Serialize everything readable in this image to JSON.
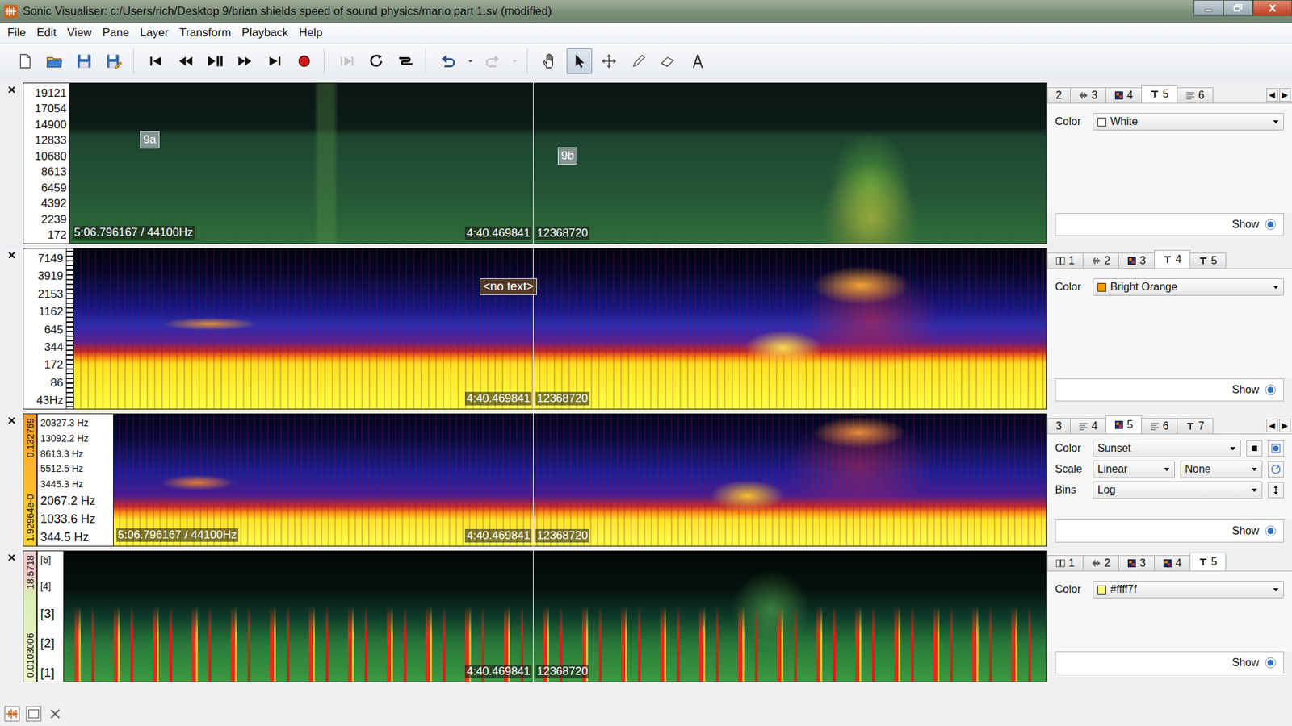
{
  "window": {
    "title": "Sonic Visualiser: c:/Users/rich/Desktop 9/brian shields speed of sound physics/mario part 1.sv (modified)"
  },
  "menu": [
    "File",
    "Edit",
    "View",
    "Pane",
    "Layer",
    "Transform",
    "Playback",
    "Help"
  ],
  "toolbar": [
    [
      {
        "kind": "new",
        "selected": false,
        "disabled": false
      },
      {
        "kind": "open",
        "selected": false,
        "disabled": false
      },
      {
        "kind": "save",
        "selected": false,
        "disabled": false
      },
      {
        "kind": "save-as",
        "selected": false,
        "disabled": false
      }
    ],
    [
      {
        "kind": "rewind-start",
        "selected": false,
        "disabled": false
      },
      {
        "kind": "rewind",
        "selected": false,
        "disabled": false
      },
      {
        "kind": "play-pause",
        "selected": false,
        "disabled": false
      },
      {
        "kind": "fast-forward",
        "selected": false,
        "disabled": false
      },
      {
        "kind": "fast-forward-end",
        "selected": false,
        "disabled": false
      },
      {
        "kind": "record",
        "selected": false,
        "disabled": false
      }
    ],
    [
      {
        "kind": "play-selection",
        "selected": false,
        "disabled": true
      },
      {
        "kind": "loop",
        "selected": false,
        "disabled": false
      },
      {
        "kind": "solo",
        "selected": false,
        "disabled": false
      }
    ],
    [
      {
        "kind": "undo",
        "selected": false,
        "disabled": false
      },
      {
        "kind": "undo-menu",
        "selected": false,
        "disabled": false
      },
      {
        "kind": "redo",
        "selected": false,
        "disabled": true
      },
      {
        "kind": "redo-menu",
        "selected": false,
        "disabled": true
      }
    ],
    [
      {
        "kind": "navigate",
        "selected": false,
        "disabled": false
      },
      {
        "kind": "select",
        "selected": true,
        "disabled": false
      },
      {
        "kind": "move",
        "selected": false,
        "disabled": false
      },
      {
        "kind": "draw",
        "selected": false,
        "disabled": false
      },
      {
        "kind": "erase",
        "selected": false,
        "disabled": false
      },
      {
        "kind": "measure",
        "selected": false,
        "disabled": false
      }
    ]
  ],
  "panes": [
    {
      "kind": "green",
      "colorbar": [],
      "scale": [
        {
          "text": "19121",
          "major": false
        },
        {
          "text": "17054",
          "major": false
        },
        {
          "text": "14900",
          "major": false
        },
        {
          "text": "12833",
          "major": false
        },
        {
          "text": "10680",
          "major": false
        },
        {
          "text": "8613",
          "major": false
        },
        {
          "text": "6459",
          "major": false
        },
        {
          "text": "4392",
          "major": false
        },
        {
          "text": "2239",
          "major": false
        },
        {
          "text": "172",
          "major": false
        }
      ],
      "labels": [
        "9a",
        "9b"
      ],
      "overlay": {
        "position": "5:06.796167 / 44100Hz",
        "time": "4:40.469841",
        "frame": "12368720"
      },
      "panel": {
        "tabs": [
          {
            "label": "2",
            "kind": "clipped",
            "selected": false
          },
          {
            "label": "3",
            "kind": "waveform",
            "selected": false
          },
          {
            "label": "4",
            "kind": "spectrogram",
            "selected": false
          },
          {
            "label": "5",
            "kind": "text",
            "selected": true
          },
          {
            "label": "6",
            "kind": "ruler",
            "selected": false
          }
        ],
        "scroll": [
          "◀",
          "▶"
        ],
        "rows": [
          {
            "label": "Color",
            "fields": [
              {
                "value": "White",
                "swatch": "#ffffff"
              }
            ],
            "buttons": []
          }
        ],
        "show": {
          "label": "Show",
          "on": true
        }
      }
    },
    {
      "kind": "melodic",
      "colorbar": [],
      "scale": [
        {
          "text": "7149",
          "major": false
        },
        {
          "text": "3919",
          "major": false
        },
        {
          "text": "2153",
          "major": false
        },
        {
          "text": "1162",
          "major": false
        },
        {
          "text": "645",
          "major": false
        },
        {
          "text": "344",
          "major": false
        },
        {
          "text": "172",
          "major": false
        },
        {
          "text": "86",
          "major": false
        },
        {
          "text": "43Hz",
          "major": false
        }
      ],
      "labels": [
        "<no text>"
      ],
      "overlay": {
        "position": "",
        "time": "4:40.469841",
        "frame": "12368720"
      },
      "panel": {
        "tabs": [
          {
            "label": "1",
            "kind": "pane",
            "selected": false
          },
          {
            "label": "2",
            "kind": "waveform",
            "selected": false
          },
          {
            "label": "3",
            "kind": "spectrogram",
            "selected": false
          },
          {
            "label": "4",
            "kind": "text",
            "selected": true
          },
          {
            "label": "5",
            "kind": "text",
            "selected": false
          }
        ],
        "scroll": [],
        "rows": [
          {
            "label": "Color",
            "fields": [
              {
                "value": "Bright Orange",
                "swatch": "#ff9a00"
              }
            ],
            "buttons": []
          }
        ],
        "show": {
          "label": "Show",
          "on": true
        }
      }
    },
    {
      "kind": "sunset",
      "colorbar": [
        "1.92964e-0",
        "0.132769"
      ],
      "scale": [
        {
          "text": "20327.3 Hz",
          "major": false
        },
        {
          "text": "13092.2 Hz",
          "major": false
        },
        {
          "text": "8613.3 Hz",
          "major": false
        },
        {
          "text": "5512.5 Hz",
          "major": false
        },
        {
          "text": "3445.3 Hz",
          "major": false
        },
        {
          "text": "2067.2 Hz",
          "major": true
        },
        {
          "text": "1033.6 Hz",
          "major": true
        },
        {
          "text": "344.5 Hz",
          "major": true
        }
      ],
      "labels": [],
      "overlay": {
        "position": "5:06.796167 / 44100Hz",
        "time": "4:40.469841",
        "frame": "12368720"
      },
      "panel": {
        "tabs": [
          {
            "label": "3",
            "kind": "clipped",
            "selected": false
          },
          {
            "label": "4",
            "kind": "ruler",
            "selected": false
          },
          {
            "label": "5",
            "kind": "spectrogram",
            "selected": true
          },
          {
            "label": "6",
            "kind": "ruler",
            "selected": false
          },
          {
            "label": "7",
            "kind": "text",
            "selected": false
          }
        ],
        "scroll": [
          "◀",
          "▶"
        ],
        "rows": [
          {
            "label": "Color",
            "fields": [
              {
                "value": "Sunset",
                "swatch": ""
              }
            ],
            "buttons": [
              "square",
              "toggle"
            ]
          },
          {
            "label": "Scale",
            "fields": [
              {
                "value": "Linear",
                "swatch": ""
              },
              {
                "value": "None",
                "swatch": ""
              }
            ],
            "buttons": [
              "dial"
            ]
          },
          {
            "label": "Bins",
            "fields": [
              {
                "value": "Log",
                "swatch": ""
              }
            ],
            "buttons": [
              "updown"
            ]
          }
        ],
        "show": {
          "label": "Show",
          "on": true
        }
      }
    },
    {
      "kind": "chroma",
      "colorbar": [
        "0.0103006",
        "18.5718"
      ],
      "scale": [
        {
          "text": "[6]",
          "major": false
        },
        {
          "text": "[4]",
          "major": false
        },
        {
          "text": "[3]",
          "major": true
        },
        {
          "text": "[2]",
          "major": true
        },
        {
          "text": "[1]",
          "major": true
        }
      ],
      "labels": [],
      "overlay": {
        "position": "",
        "time": "4:40.469841",
        "frame": "12368720"
      },
      "panel": {
        "tabs": [
          {
            "label": "1",
            "kind": "pane",
            "selected": false
          },
          {
            "label": "2",
            "kind": "waveform",
            "selected": false
          },
          {
            "label": "3",
            "kind": "spectrogram",
            "selected": false
          },
          {
            "label": "4",
            "kind": "spectrogram",
            "selected": false
          },
          {
            "label": "5",
            "kind": "text",
            "selected": true
          }
        ],
        "scroll": [],
        "rows": [
          {
            "label": "Color",
            "fields": [
              {
                "value": "#ffff7f",
                "swatch": "#ffff7f"
              }
            ],
            "buttons": []
          }
        ],
        "show": {
          "label": "Show",
          "on": true
        }
      }
    }
  ]
}
